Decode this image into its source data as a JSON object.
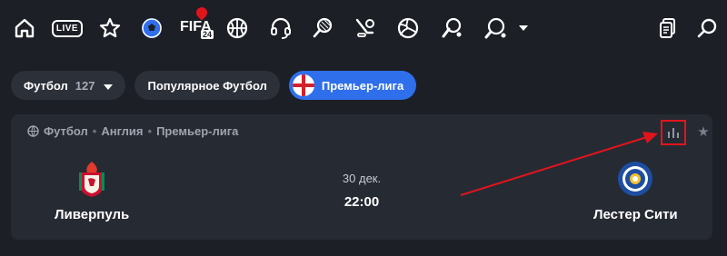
{
  "header": {
    "icons": [
      "home-icon",
      "live-icon",
      "star-icon",
      "football-icon",
      "fifa-icon",
      "basketball-icon",
      "esports-headset-icon",
      "tennis-icon",
      "hockey-icon",
      "volleyball-icon",
      "cricket-icon",
      "table-tennis-icon",
      "more-chevron-icon",
      "betslip-icon",
      "search-icon"
    ],
    "live_label": "LIVE",
    "fifa_label": "FIFA",
    "fifa_year": "24"
  },
  "filters": {
    "sport": {
      "label": "Футбол",
      "count": "127"
    },
    "popular": {
      "label": "Популярное Футбол"
    },
    "league": {
      "label": "Премьер-лига"
    }
  },
  "match": {
    "breadcrumb": {
      "sport": "Футбол",
      "country": "Англия",
      "league": "Премьер-лига"
    },
    "home_team": "Ливерпуль",
    "away_team": "Лестер Сити",
    "date": "30 дек.",
    "time": "22:00"
  },
  "colors": {
    "background": "#1c1f26",
    "card": "#262a33",
    "chip": "#2c3039",
    "accent": "#2f6fec",
    "highlight": "#e1141c"
  }
}
